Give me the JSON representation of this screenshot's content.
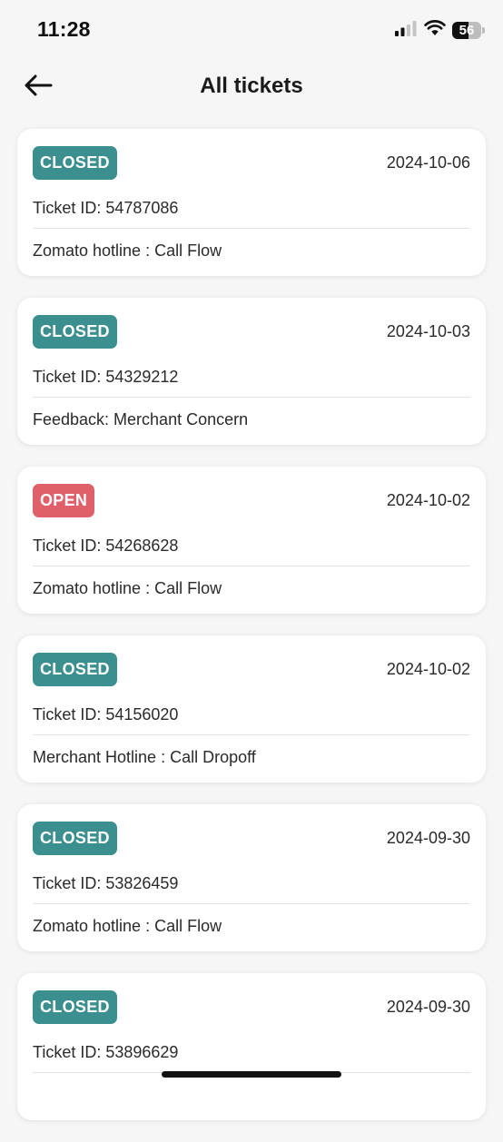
{
  "status_bar": {
    "time": "11:28",
    "battery": "56"
  },
  "header": {
    "title": "All tickets"
  },
  "colors": {
    "closed": "#3b8f8f",
    "open": "#e0606a"
  },
  "tickets": [
    {
      "status": "CLOSED",
      "date": "2024-10-06",
      "id_label": "Ticket ID: 54787086",
      "category": "Zomato hotline : Call Flow"
    },
    {
      "status": "CLOSED",
      "date": "2024-10-03",
      "id_label": "Ticket ID: 54329212",
      "category": "Feedback: Merchant Concern"
    },
    {
      "status": "OPEN",
      "date": "2024-10-02",
      "id_label": "Ticket ID: 54268628",
      "category": "Zomato hotline : Call Flow"
    },
    {
      "status": "CLOSED",
      "date": "2024-10-02",
      "id_label": "Ticket ID: 54156020",
      "category": "Merchant Hotline : Call Dropoff"
    },
    {
      "status": "CLOSED",
      "date": "2024-09-30",
      "id_label": "Ticket ID: 53826459",
      "category": "Zomato hotline : Call Flow"
    },
    {
      "status": "CLOSED",
      "date": "2024-09-30",
      "id_label": "Ticket ID: 53896629",
      "category": ""
    }
  ]
}
